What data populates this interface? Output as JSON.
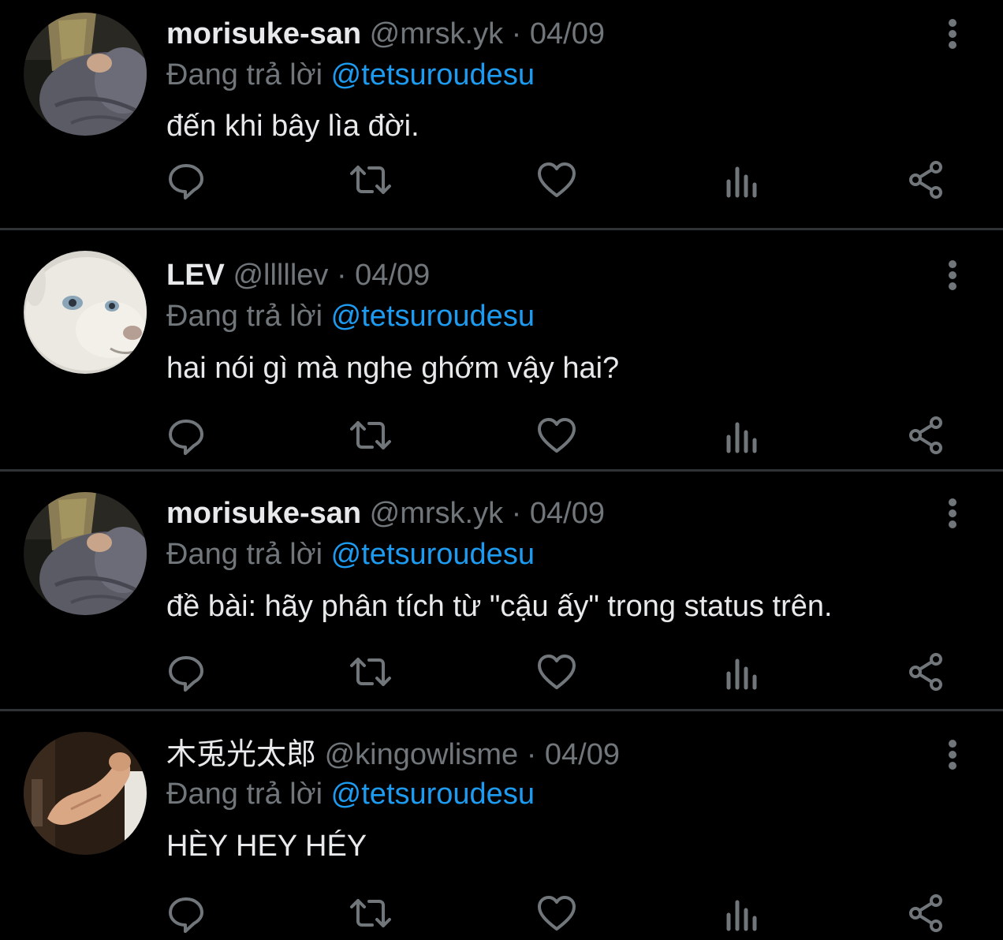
{
  "colors": {
    "background": "#000000",
    "divider": "#2f3336",
    "text_primary": "#e7e9ea",
    "text_secondary": "#71767b",
    "link": "#1d9bf0",
    "icon": "#71767b"
  },
  "tweets": [
    {
      "display_name": "morisuke-san",
      "handle": "@mrsk.yk",
      "separator": "·",
      "date": "04/09",
      "reply_prefix": "Đang trả lời",
      "reply_to": "@tetsuroudesu",
      "text": "đến khi bây lìa đời.",
      "avatar_icon": "avatar-person-gray-sweater"
    },
    {
      "display_name": "LEV",
      "handle": "@lllllev",
      "separator": "·",
      "date": "04/09",
      "reply_prefix": "Đang trả lời",
      "reply_to": "@tetsuroudesu",
      "text": "hai nói gì mà nghe ghớm vậy hai?",
      "avatar_icon": "avatar-white-lion-cub"
    },
    {
      "display_name": "morisuke-san",
      "handle": "@mrsk.yk",
      "separator": "·",
      "date": "04/09",
      "reply_prefix": "Đang trả lời",
      "reply_to": "@tetsuroudesu",
      "text": "đề bài: hãy phân tích từ \"cậu ấy\" trong status trên.",
      "avatar_icon": "avatar-person-gray-sweater"
    },
    {
      "display_name": "木兎光太郎",
      "handle": "@kingowlisme",
      "separator": "·",
      "date": "04/09",
      "reply_prefix": "Đang trả lời",
      "reply_to": "@tetsuroudesu",
      "text": "HÈY HEY HÉY",
      "avatar_icon": "avatar-flexing-arm"
    }
  ],
  "actions": [
    {
      "name": "reply",
      "icon": "reply-icon"
    },
    {
      "name": "retweet",
      "icon": "retweet-icon"
    },
    {
      "name": "like",
      "icon": "heart-icon"
    },
    {
      "name": "views",
      "icon": "analytics-icon"
    },
    {
      "name": "share",
      "icon": "share-icon"
    }
  ]
}
